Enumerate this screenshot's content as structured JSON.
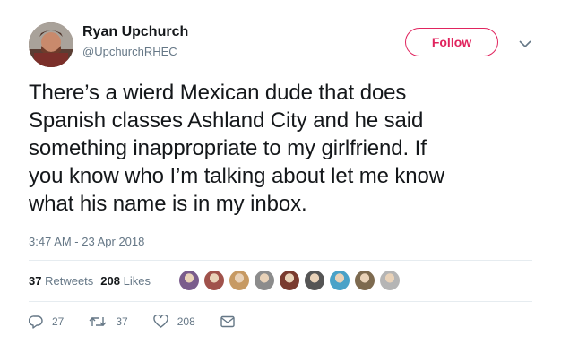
{
  "user": {
    "name": "Ryan Upchurch",
    "handle": "@UpchurchRHEC"
  },
  "follow_label": "Follow",
  "tweet": {
    "lines": [
      "There’s a wierd Mexican dude that does",
      "Spanish classes Ashland City and he said",
      "something inappropriate to my girlfriend. If",
      "you know who I’m talking about let me know",
      "what his name is in my inbox."
    ],
    "timestamp": "3:47 AM - 23 Apr 2018"
  },
  "stats": {
    "retweets_count": "37",
    "retweets_label": "Retweets",
    "likes_count": "208",
    "likes_label": "Likes"
  },
  "liker_avatar_colors": [
    "#7a5c8c",
    "#a0524b",
    "#c79a63",
    "#8c8c8c",
    "#7a3a2e",
    "#555555",
    "#4aa2c8",
    "#7d6a4f",
    "#b5b5b5"
  ],
  "actions": {
    "reply_count": "27",
    "retweet_count": "37",
    "like_count": "208"
  },
  "colors": {
    "accent_follow": "#e0245e",
    "muted": "#657786"
  }
}
